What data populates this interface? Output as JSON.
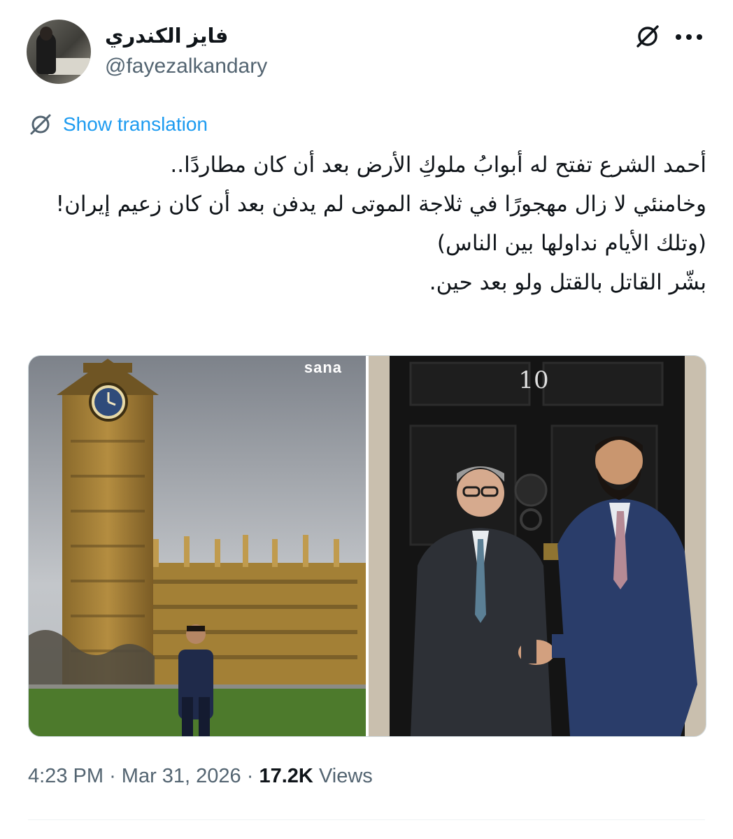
{
  "author": {
    "display_name": "فايز الكندري",
    "handle": "@fayezalkandary"
  },
  "icons": {
    "header_action": "grok-icon",
    "more": "more-icon",
    "translate": "translate-icon"
  },
  "translation": {
    "link_label": "Show translation"
  },
  "tweet": {
    "lines": [
      "أحمد الشرع تفتح له أبوابُ ملوكِ الأرض بعد أن كان مطاردًا..",
      "وخامنئي لا زال مهجورًا في ثلاجة الموتى لم يدفن بعد أن كان زعيم إيران!",
      "(وتلك الأيام نداولها بين الناس)",
      "بشّر القاتل بالقتل ولو بعد حين."
    ]
  },
  "media": {
    "left_watermark": "sana"
  },
  "meta": {
    "time": "4:23 PM",
    "separator": "·",
    "date": "Mar 31, 2026",
    "views_count": "17.2K",
    "views_label": "Views"
  },
  "colors": {
    "link": "#1d9bf0",
    "secondary_text": "#536471",
    "primary_text": "#0f1419"
  }
}
